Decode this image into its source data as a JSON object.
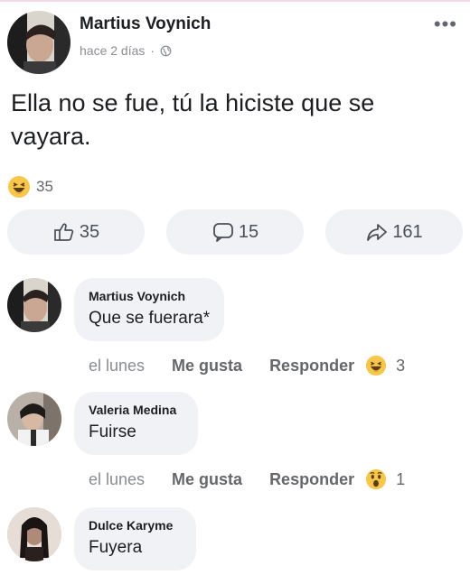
{
  "post": {
    "author": "Martius Voynich",
    "time": "hace 2 días",
    "separator": "·",
    "privacy_icon": "globe-icon",
    "more_icon": "more-options-icon",
    "text": "Ella no se fue, tú la hiciste que se vayara.",
    "reaction": {
      "icon": "haha-emoji",
      "count": "35"
    },
    "actions": {
      "like_count": "35",
      "comment_count": "15",
      "share_count": "161"
    }
  },
  "comments": [
    {
      "author": "Martius Voynich",
      "text": "Que se fuerara*",
      "time": "el lunes",
      "like_label": "Me gusta",
      "reply_label": "Responder",
      "reaction": {
        "icon": "haha-emoji",
        "count": "3"
      }
    },
    {
      "author": "Valeria Medina",
      "text": "Fuirse",
      "time": "el lunes",
      "like_label": "Me gusta",
      "reply_label": "Responder",
      "reaction": {
        "icon": "wow-emoji",
        "count": "1"
      }
    },
    {
      "author": "Dulce Karyme",
      "text": "Fuyera"
    }
  ],
  "colors": {
    "bubble": "#f0f2f5",
    "text": "#1c1e21",
    "muted": "#65676b",
    "emoji_yellow": "#f7c64b"
  }
}
